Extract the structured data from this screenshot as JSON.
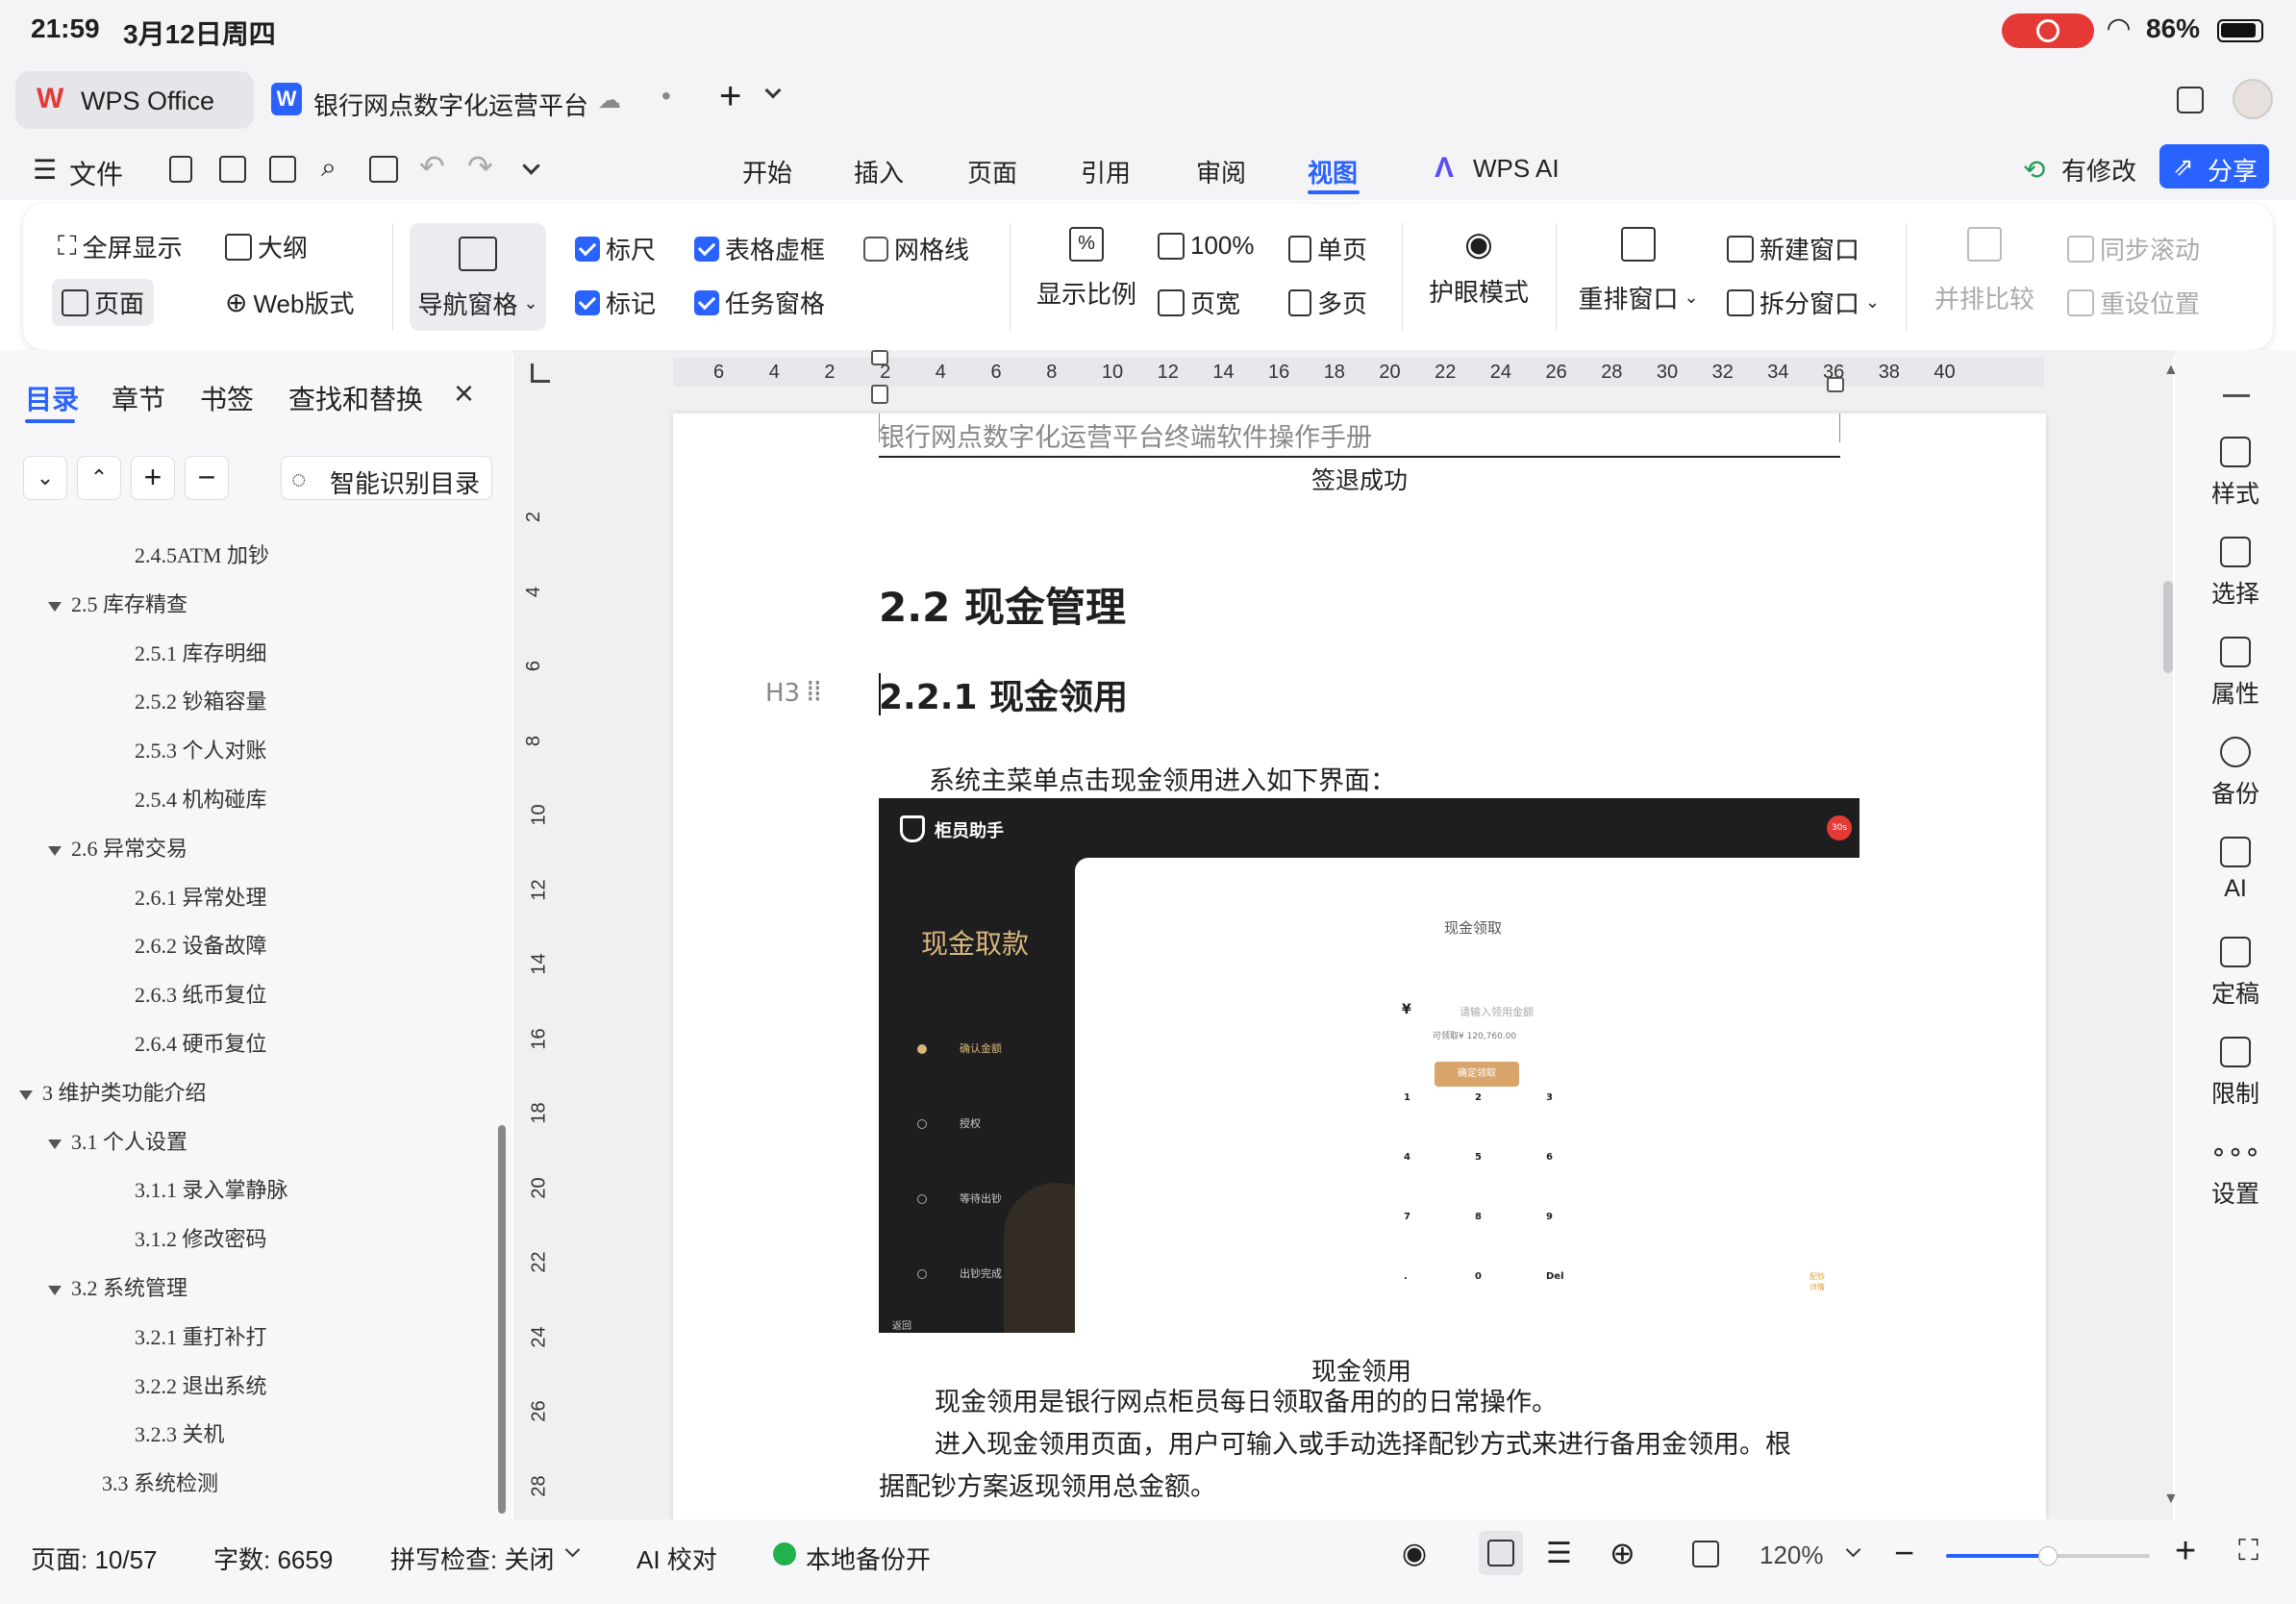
{
  "status": {
    "time": "21:59",
    "date": "3月12日周四",
    "battery": "86%"
  },
  "tabs": {
    "home": "WPS Office",
    "doc": "银行网点数字化运营平台"
  },
  "menu": {
    "file": "文件",
    "items": [
      "开始",
      "插入",
      "页面",
      "引用",
      "审阅",
      "视图"
    ],
    "ai": "WPS AI",
    "modified": "有修改",
    "share": "分享"
  },
  "ribbon": {
    "fullscreen": "全屏显示",
    "outline": "大纲",
    "page": "页面",
    "web": "Web版式",
    "nav_pane": "导航窗格",
    "ruler": "标尺",
    "marks": "标记",
    "table_grid": "表格虚框",
    "task_pane": "任务窗格",
    "gridlines": "网格线",
    "zoom_ratio": "显示比例",
    "zoom100": "100%",
    "page_width": "页宽",
    "single": "单页",
    "multi": "多页",
    "eye_mode": "护眼模式",
    "rearrange": "重排窗口",
    "new_window": "新建窗口",
    "split": "拆分窗口",
    "side_by_side": "并排比较",
    "sync_scroll": "同步滚动",
    "reset_pos": "重设位置"
  },
  "nav": {
    "tabs": [
      "目录",
      "章节",
      "书签",
      "查找和替换"
    ],
    "smart": "智能识别目录",
    "toc": [
      {
        "t": "2.4.5ATM 加钞",
        "l": 3,
        "e": false
      },
      {
        "t": "2.5 库存精查",
        "l": 2,
        "e": true
      },
      {
        "t": "2.5.1 库存明细",
        "l": 3,
        "e": false
      },
      {
        "t": "2.5.2 钞箱容量",
        "l": 3,
        "e": false
      },
      {
        "t": "2.5.3 个人对账",
        "l": 3,
        "e": false
      },
      {
        "t": "2.5.4 机构碰库",
        "l": 3,
        "e": false
      },
      {
        "t": "2.6 异常交易",
        "l": 2,
        "e": true
      },
      {
        "t": "2.6.1 异常处理",
        "l": 3,
        "e": false
      },
      {
        "t": "2.6.2 设备故障",
        "l": 3,
        "e": false
      },
      {
        "t": "2.6.3 纸币复位",
        "l": 3,
        "e": false
      },
      {
        "t": "2.6.4 硬币复位",
        "l": 3,
        "e": false
      },
      {
        "t": "3 维护类功能介绍",
        "l": 1,
        "e": true
      },
      {
        "t": "3.1 个人设置",
        "l": 2,
        "e": true
      },
      {
        "t": "3.1.1 录入掌静脉",
        "l": 3,
        "e": false
      },
      {
        "t": "3.1.2 修改密码",
        "l": 3,
        "e": false
      },
      {
        "t": "3.2 系统管理",
        "l": 2,
        "e": true
      },
      {
        "t": "3.2.1 重打补打",
        "l": 3,
        "e": false
      },
      {
        "t": "3.2.2 退出系统",
        "l": 3,
        "e": false
      },
      {
        "t": "3.2.3 关机",
        "l": 3,
        "e": false
      },
      {
        "t": "3.3 系统检测",
        "l": 2,
        "e": false
      }
    ]
  },
  "ruler": {
    "h": [
      "6",
      "4",
      "2",
      "2",
      "4",
      "6",
      "8",
      "10",
      "12",
      "14",
      "16",
      "18",
      "20",
      "22",
      "24",
      "26",
      "28",
      "30",
      "32",
      "34",
      "36",
      "38",
      "40"
    ],
    "v": [
      "2",
      "4",
      "6",
      "8",
      "10",
      "12",
      "14",
      "16",
      "18",
      "20",
      "22",
      "24",
      "26",
      "28"
    ]
  },
  "doc": {
    "header": "银行网点数字化运营平台终端软件操作手册",
    "signout": "签退成功",
    "h2": "2.2 现金管理",
    "h3": "2.2.1 现金领用",
    "h3_marker": "H3",
    "p1": "系统主菜单点击现金领用进入如下界面：",
    "shot": {
      "app": "柜员助手",
      "badge": "30s",
      "side_title": "现金取款",
      "steps": [
        "确认金额",
        "授权",
        "等待出钞",
        "出钞完成"
      ],
      "back": "返回",
      "panel_title": "现金领取",
      "yen": "¥",
      "input_ph": "请输入领用金额",
      "avail": "可领取¥ 120,760.00",
      "confirm": "确定领取",
      "keys": [
        "1",
        "2",
        "3",
        "4",
        "5",
        "6",
        "7",
        "8",
        "9",
        ".",
        "0",
        "Del"
      ],
      "corner": "配钞\n详情"
    },
    "caption": "现金领用",
    "p2": "现金领用是银行网点柜员每日领取备用的的日常操作。",
    "p3a": "进入现金领用页面，用户可输入或手动选择配钞方式来进行备用金领用。根",
    "p3b": "据配钞方案返现领用总金额。"
  },
  "rightbar": [
    "样式",
    "选择",
    "属性",
    "备份",
    "AI",
    "定稿",
    "限制",
    "设置"
  ],
  "statusbar": {
    "page": "页面: 10/57",
    "words": "字数: 6659",
    "spell": "拼写检查: 关闭",
    "ai_check": "AI 校对",
    "backup": "本地备份开",
    "zoom": "120%",
    "zoom_fraction": 0.5
  }
}
